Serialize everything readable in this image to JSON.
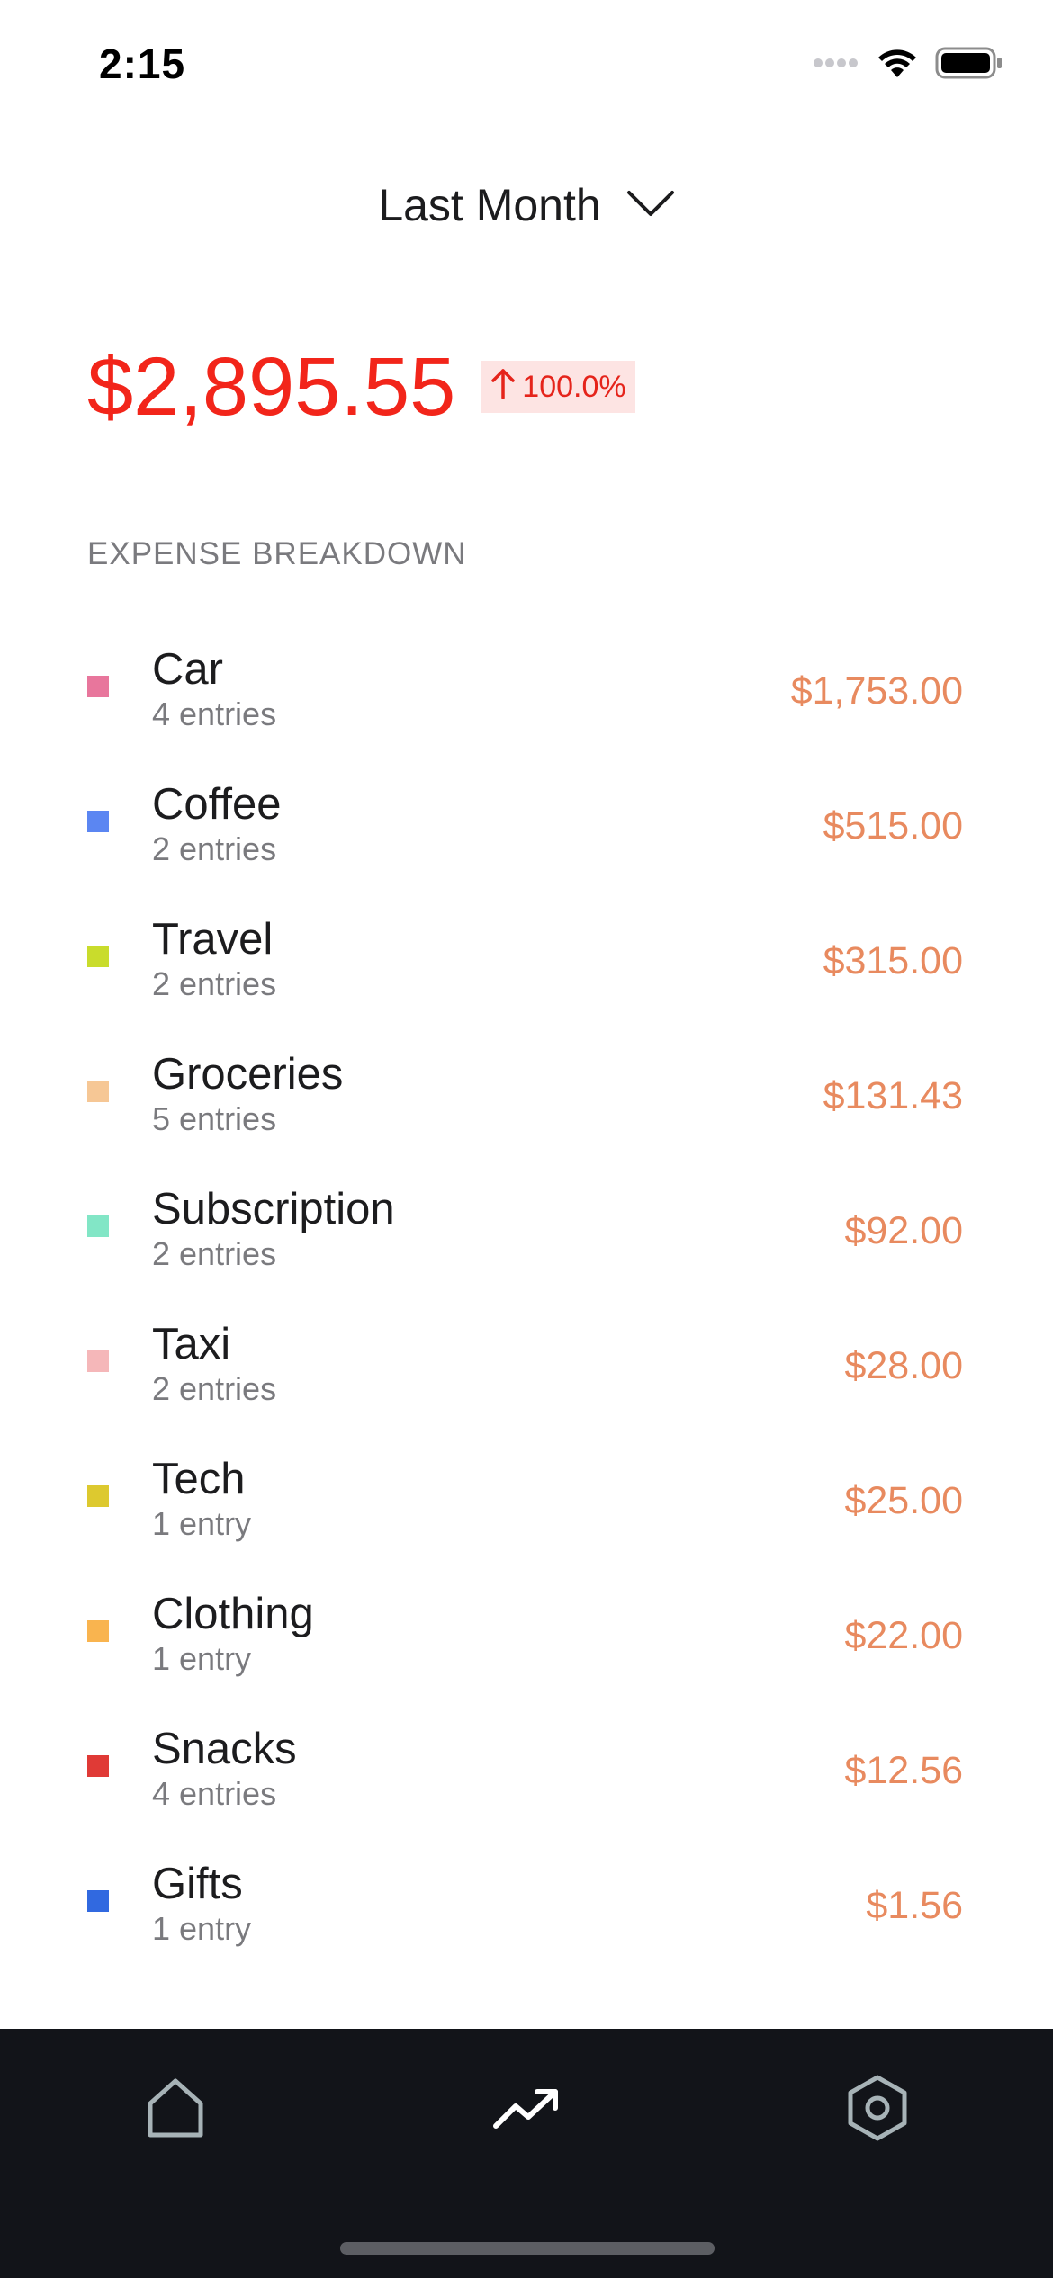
{
  "status_bar": {
    "time": "2:15",
    "icons": [
      "signal-icon",
      "wifi-icon",
      "battery-icon"
    ]
  },
  "period": {
    "label": "Last Month",
    "icon": "chevron-down-icon"
  },
  "summary": {
    "total": "$2,895.55",
    "change": "100.0%",
    "change_direction": "up",
    "total_color": "#f2251a"
  },
  "breakdown": {
    "title": "EXPENSE BREAKDOWN",
    "items": [
      {
        "name": "Car",
        "count": "4 entries",
        "amount": "$1,753.00",
        "color": "#e8769c"
      },
      {
        "name": "Coffee",
        "count": "2 entries",
        "amount": "$515.00",
        "color": "#5b86f2"
      },
      {
        "name": "Travel",
        "count": "2 entries",
        "amount": "$315.00",
        "color": "#c9dc2c"
      },
      {
        "name": "Groceries",
        "count": "5 entries",
        "amount": "$131.43",
        "color": "#f6c795"
      },
      {
        "name": "Subscription",
        "count": "2 entries",
        "amount": "$92.00",
        "color": "#82e6c6"
      },
      {
        "name": "Taxi",
        "count": "2 entries",
        "amount": "$28.00",
        "color": "#f5b7b9"
      },
      {
        "name": "Tech",
        "count": "1 entry",
        "amount": "$25.00",
        "color": "#ddc92f"
      },
      {
        "name": "Clothing",
        "count": "1 entry",
        "amount": "$22.00",
        "color": "#f9b44f"
      },
      {
        "name": "Snacks",
        "count": "4 entries",
        "amount": "$12.56",
        "color": "#e03a36"
      },
      {
        "name": "Gifts",
        "count": "1 entry",
        "amount": "$1.56",
        "color": "#3169e0"
      }
    ]
  },
  "tab_bar": {
    "tabs": [
      {
        "icon": "home-icon",
        "active": false
      },
      {
        "icon": "trending-up-icon",
        "active": true
      },
      {
        "icon": "settings-hexagon-icon",
        "active": false
      }
    ]
  },
  "colors": {
    "amount": "#e88a5f",
    "tab_bar_bg": "#121419"
  }
}
